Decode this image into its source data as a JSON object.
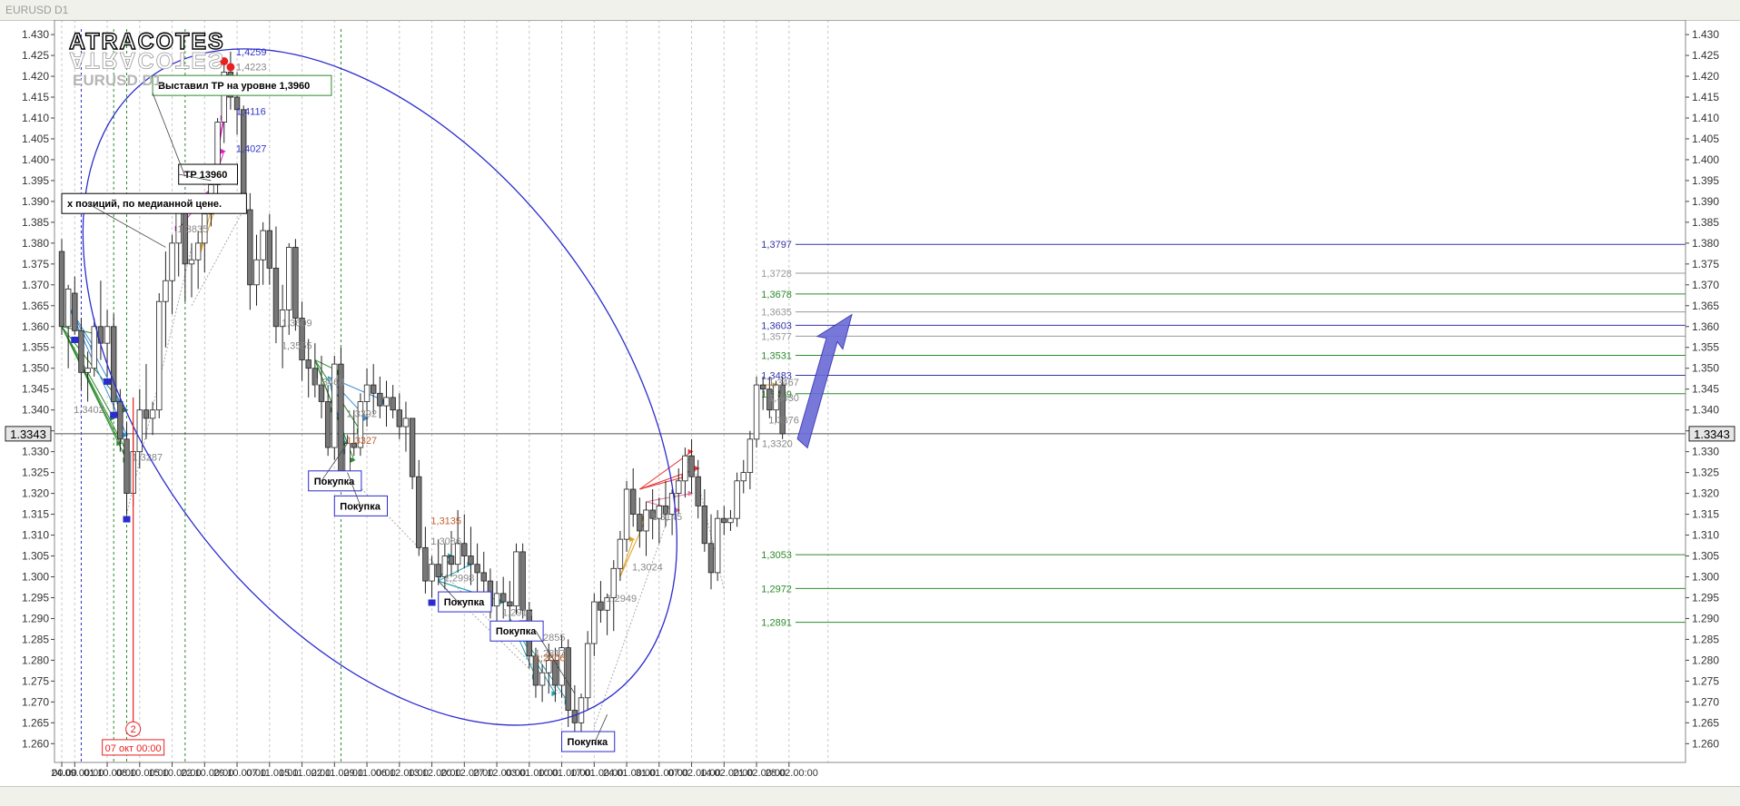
{
  "window": {
    "title": "EURUSD D1"
  },
  "brand": {
    "logo_text": "ATRACOTES",
    "symbol": "EURUSD D1"
  },
  "colors": {
    "bull": "#ffffff",
    "bear": "#777777",
    "accent_blue": "#2b2bd0",
    "accent_red": "#e82020",
    "axis": "#444444"
  },
  "chart_data": {
    "type": "candlestick",
    "ylim": [
      1.2555,
      1.4335
    ],
    "yticks": [
      "1.430",
      "1.425",
      "1.420",
      "1.415",
      "1.410",
      "1.405",
      "1.400",
      "1.395",
      "1.390",
      "1.385",
      "1.380",
      "1.375",
      "1.370",
      "1.365",
      "1.360",
      "1.355",
      "1.350",
      "1.345",
      "1.340",
      "1.335",
      "1.330",
      "1.325",
      "1.320",
      "1.315",
      "1.310",
      "1.305",
      "1.300",
      "1.295",
      "1.290",
      "1.285",
      "1.280",
      "1.275",
      "1.270",
      "1.265",
      "1.260"
    ],
    "current_price": "1.3343",
    "xticks": [
      {
        "label": "00.00",
        "bar": 0
      },
      {
        "label": "24.09.00:00",
        "bar": 2
      },
      {
        "label": "01.10.00:00",
        "bar": 7
      },
      {
        "label": "08.10.00:00",
        "bar": 12
      },
      {
        "label": "15.10.00:00",
        "bar": 17
      },
      {
        "label": "22.10.00:00",
        "bar": 22
      },
      {
        "label": "29.10.00:00",
        "bar": 27
      },
      {
        "label": "07.11.00:00",
        "bar": 32
      },
      {
        "label": "15.11.00:00",
        "bar": 37
      },
      {
        "label": "22.11.00:00",
        "bar": 42
      },
      {
        "label": "29.11.00:00",
        "bar": 47
      },
      {
        "label": "06.12.00:00",
        "bar": 52
      },
      {
        "label": "13.12.00:00",
        "bar": 57
      },
      {
        "label": "20.12.00:00",
        "bar": 62
      },
      {
        "label": "27.12.00:00",
        "bar": 67
      },
      {
        "label": "03.01.00:00",
        "bar": 72
      },
      {
        "label": "10.01.00:00",
        "bar": 77
      },
      {
        "label": "17.01.00:00",
        "bar": 82
      },
      {
        "label": "24.01.00:00",
        "bar": 87
      },
      {
        "label": "31.01.00:00",
        "bar": 92
      },
      {
        "label": "07.02.00:00",
        "bar": 97
      },
      {
        "label": "14.02.00:00",
        "bar": 102
      },
      {
        "label": "21.02.00:00",
        "bar": 107
      },
      {
        "label": "28.02.00:00",
        "bar": 112
      }
    ],
    "candles": [
      [
        1.378,
        1.381,
        1.358,
        1.36
      ],
      [
        1.36,
        1.37,
        1.35,
        1.369
      ],
      [
        1.368,
        1.372,
        1.358,
        1.359
      ],
      [
        1.359,
        1.362,
        1.345,
        1.349
      ],
      [
        1.349,
        1.354,
        1.342,
        1.35
      ],
      [
        1.35,
        1.362,
        1.348,
        1.36
      ],
      [
        1.36,
        1.371,
        1.352,
        1.356
      ],
      [
        1.356,
        1.364,
        1.348,
        1.36
      ],
      [
        1.36,
        1.363,
        1.34,
        1.342
      ],
      [
        1.342,
        1.345,
        1.33,
        1.333
      ],
      [
        1.333,
        1.337,
        1.315,
        1.32
      ],
      [
        1.32,
        1.334,
        1.317,
        1.33
      ],
      [
        1.33,
        1.345,
        1.326,
        1.34
      ],
      [
        1.34,
        1.351,
        1.333,
        1.338
      ],
      [
        1.338,
        1.342,
        1.334,
        1.34
      ],
      [
        1.34,
        1.368,
        1.338,
        1.366
      ],
      [
        1.366,
        1.378,
        1.355,
        1.371
      ],
      [
        1.371,
        1.382,
        1.363,
        1.38
      ],
      [
        1.38,
        1.39,
        1.372,
        1.388
      ],
      [
        1.388,
        1.391,
        1.366,
        1.375
      ],
      [
        1.375,
        1.38,
        1.367,
        1.376
      ],
      [
        1.376,
        1.383,
        1.369,
        1.38
      ],
      [
        1.38,
        1.39,
        1.373,
        1.387
      ],
      [
        1.387,
        1.397,
        1.384,
        1.394
      ],
      [
        1.394,
        1.41,
        1.388,
        1.409
      ],
      [
        1.409,
        1.424,
        1.404,
        1.421
      ],
      [
        1.421,
        1.4259,
        1.412,
        1.415
      ],
      [
        1.415,
        1.421,
        1.406,
        1.412
      ],
      [
        1.412,
        1.413,
        1.387,
        1.388
      ],
      [
        1.388,
        1.392,
        1.364,
        1.37
      ],
      [
        1.37,
        1.382,
        1.365,
        1.376
      ],
      [
        1.376,
        1.385,
        1.37,
        1.383
      ],
      [
        1.383,
        1.387,
        1.37,
        1.374
      ],
      [
        1.374,
        1.384,
        1.356,
        1.36
      ],
      [
        1.36,
        1.37,
        1.35,
        1.364
      ],
      [
        1.364,
        1.38,
        1.358,
        1.379
      ],
      [
        1.379,
        1.381,
        1.359,
        1.362
      ],
      [
        1.362,
        1.366,
        1.347,
        1.352
      ],
      [
        1.352,
        1.357,
        1.343,
        1.35
      ],
      [
        1.35,
        1.356,
        1.343,
        1.346
      ],
      [
        1.346,
        1.353,
        1.338,
        1.342
      ],
      [
        1.342,
        1.346,
        1.329,
        1.331
      ],
      [
        1.331,
        1.353,
        1.328,
        1.351
      ],
      [
        1.351,
        1.355,
        1.323,
        1.324
      ],
      [
        1.324,
        1.334,
        1.322,
        1.332
      ],
      [
        1.332,
        1.34,
        1.329,
        1.331
      ],
      [
        1.331,
        1.344,
        1.329,
        1.342
      ],
      [
        1.342,
        1.35,
        1.336,
        1.346
      ],
      [
        1.346,
        1.351,
        1.339,
        1.344
      ],
      [
        1.344,
        1.348,
        1.338,
        1.341
      ],
      [
        1.341,
        1.347,
        1.336,
        1.343
      ],
      [
        1.343,
        1.346,
        1.338,
        1.34
      ],
      [
        1.34,
        1.344,
        1.333,
        1.336
      ],
      [
        1.336,
        1.342,
        1.33,
        1.338
      ],
      [
        1.338,
        1.338,
        1.321,
        1.324
      ],
      [
        1.324,
        1.328,
        1.305,
        1.307
      ],
      [
        1.307,
        1.312,
        1.296,
        1.299
      ],
      [
        1.299,
        1.305,
        1.295,
        1.303
      ],
      [
        1.303,
        1.309,
        1.298,
        1.3
      ],
      [
        1.3,
        1.308,
        1.297,
        1.305
      ],
      [
        1.305,
        1.311,
        1.3,
        1.303
      ],
      [
        1.303,
        1.316,
        1.301,
        1.308
      ],
      [
        1.308,
        1.315,
        1.302,
        1.305
      ],
      [
        1.305,
        1.312,
        1.298,
        1.303
      ],
      [
        1.303,
        1.308,
        1.296,
        1.301
      ],
      [
        1.301,
        1.306,
        1.293,
        1.299
      ],
      [
        1.299,
        1.302,
        1.29,
        1.293
      ],
      [
        1.293,
        1.299,
        1.288,
        1.296
      ],
      [
        1.296,
        1.3,
        1.29,
        1.294
      ],
      [
        1.294,
        1.299,
        1.288,
        1.293
      ],
      [
        1.293,
        1.308,
        1.291,
        1.306
      ],
      [
        1.306,
        1.308,
        1.29,
        1.292
      ],
      [
        1.292,
        1.294,
        1.278,
        1.281
      ],
      [
        1.281,
        1.283,
        1.271,
        1.274
      ],
      [
        1.274,
        1.279,
        1.27,
        1.277
      ],
      [
        1.277,
        1.284,
        1.272,
        1.28
      ],
      [
        1.28,
        1.283,
        1.27,
        1.274
      ],
      [
        1.274,
        1.286,
        1.271,
        1.283
      ],
      [
        1.283,
        1.285,
        1.264,
        1.268
      ],
      [
        1.268,
        1.274,
        1.261,
        1.265
      ],
      [
        1.265,
        1.272,
        1.26,
        1.271
      ],
      [
        1.271,
        1.287,
        1.268,
        1.284
      ],
      [
        1.284,
        1.296,
        1.281,
        1.294
      ],
      [
        1.294,
        1.299,
        1.289,
        1.292
      ],
      [
        1.292,
        1.296,
        1.286,
        1.295
      ],
      [
        1.295,
        1.304,
        1.287,
        1.302
      ],
      [
        1.302,
        1.311,
        1.299,
        1.309
      ],
      [
        1.309,
        1.323,
        1.306,
        1.321
      ],
      [
        1.321,
        1.326,
        1.312,
        1.315
      ],
      [
        1.315,
        1.319,
        1.307,
        1.311
      ],
      [
        1.311,
        1.318,
        1.305,
        1.316
      ],
      [
        1.316,
        1.321,
        1.309,
        1.314
      ],
      [
        1.314,
        1.319,
        1.308,
        1.317
      ],
      [
        1.317,
        1.323,
        1.312,
        1.315
      ],
      [
        1.315,
        1.321,
        1.31,
        1.32
      ],
      [
        1.32,
        1.326,
        1.315,
        1.323
      ],
      [
        1.323,
        1.331,
        1.319,
        1.329
      ],
      [
        1.329,
        1.333,
        1.32,
        1.324
      ],
      [
        1.324,
        1.328,
        1.314,
        1.317
      ],
      [
        1.317,
        1.321,
        1.306,
        1.308
      ],
      [
        1.308,
        1.315,
        1.297,
        1.301
      ],
      [
        1.301,
        1.316,
        1.299,
        1.314
      ],
      [
        1.314,
        1.317,
        1.31,
        1.313
      ],
      [
        1.313,
        1.316,
        1.311,
        1.314
      ],
      [
        1.314,
        1.325,
        1.312,
        1.323
      ],
      [
        1.323,
        1.328,
        1.32,
        1.325
      ],
      [
        1.325,
        1.335,
        1.321,
        1.333
      ],
      [
        1.333,
        1.348,
        1.331,
        1.346
      ],
      [
        1.346,
        1.348,
        1.34,
        1.345
      ],
      [
        1.345,
        1.348,
        1.338,
        1.34
      ],
      [
        1.34,
        1.347,
        1.337,
        1.346
      ],
      [
        1.346,
        1.348,
        1.333,
        1.3343
      ]
    ],
    "level_lines": [
      {
        "label": "1,3797",
        "price": 1.3797,
        "color": "#3333aa"
      },
      {
        "label": "1,3728",
        "price": 1.3728,
        "color": "#999999"
      },
      {
        "label": "1,3678",
        "price": 1.3678,
        "color": "#2c8a2c"
      },
      {
        "label": "1,3635",
        "price": 1.3635,
        "color": "#999999"
      },
      {
        "label": "1,3603",
        "price": 1.3603,
        "color": "#3333aa"
      },
      {
        "label": "1,3577",
        "price": 1.3577,
        "color": "#999999"
      },
      {
        "label": "1,3531",
        "price": 1.3531,
        "color": "#2c8a2c"
      },
      {
        "label": "1,3483",
        "price": 1.3483,
        "color": "#3333aa"
      },
      {
        "label": "1,3439",
        "price": 1.3439,
        "color": "#2c8a2c"
      },
      {
        "label": "1,3053",
        "price": 1.3053,
        "color": "#2c8a2c"
      },
      {
        "label": "1,2972",
        "price": 1.2972,
        "color": "#2c8a2c"
      },
      {
        "label": "1,2891",
        "price": 1.2891,
        "color": "#2c8a2c"
      }
    ],
    "price_labels": [
      {
        "label": "1,4259",
        "bar": 26,
        "price": 1.4259,
        "color": "#3333cc"
      },
      {
        "label": "1,4223",
        "bar": 26,
        "price": 1.4223,
        "color": "#888888"
      },
      {
        "label": "1,4116",
        "bar": 26,
        "price": 1.4116,
        "color": "#3333cc"
      },
      {
        "label": "1,4027",
        "bar": 26,
        "price": 1.4027,
        "color": "#3333cc"
      },
      {
        "label": "1,3835",
        "bar": 17,
        "price": 1.3835,
        "color": "#888888"
      },
      {
        "label": "1,3609",
        "bar": 33,
        "price": 1.3609,
        "color": "#888888"
      },
      {
        "label": "1,3555",
        "bar": 33,
        "price": 1.3555,
        "color": "#888888"
      },
      {
        "label": "1,3468",
        "bar": 38,
        "price": 1.3468,
        "color": "#888888"
      },
      {
        "label": "1,3402",
        "bar": 1,
        "price": 1.3402,
        "color": "#888888"
      },
      {
        "label": "1,3392",
        "bar": 43,
        "price": 1.3392,
        "color": "#888888"
      },
      {
        "label": "1,3327",
        "bar": 43,
        "price": 1.3327,
        "color": "#c06030"
      },
      {
        "label": "1,3287",
        "bar": 10,
        "price": 1.3287,
        "color": "#888888"
      },
      {
        "label": "1,3135",
        "bar": 56,
        "price": 1.3135,
        "color": "#c06030"
      },
      {
        "label": "1,3086",
        "bar": 56,
        "price": 1.3086,
        "color": "#888888"
      },
      {
        "label": "1,3145",
        "bar": 90,
        "price": 1.3145,
        "color": "#888888"
      },
      {
        "label": "1,3024",
        "bar": 87,
        "price": 1.3024,
        "color": "#888888"
      },
      {
        "label": "1,2998",
        "bar": 58,
        "price": 1.2998,
        "color": "#888888"
      },
      {
        "label": "1,2949",
        "bar": 83,
        "price": 1.2949,
        "color": "#888888"
      },
      {
        "label": "1,2915",
        "bar": 67,
        "price": 1.2915,
        "color": "#888888"
      },
      {
        "label": "1,2878",
        "bar": 68,
        "price": 1.2878,
        "color": "#888888"
      },
      {
        "label": "1,2855",
        "bar": 72,
        "price": 1.2855,
        "color": "#888888"
      },
      {
        "label": "1,2817",
        "bar": 72,
        "price": 1.2817,
        "color": "#888888"
      },
      {
        "label": "1,2806",
        "bar": 72,
        "price": 1.2806,
        "color": "#c06030"
      },
      {
        "label": "1,3467",
        "bar": 108,
        "price": 1.3467,
        "color": "#888888"
      },
      {
        "label": "1,3430",
        "bar": 108,
        "price": 1.343,
        "color": "#888888"
      },
      {
        "label": "1,3376",
        "bar": 108,
        "price": 1.3376,
        "color": "#888888"
      },
      {
        "label": "1,3320",
        "bar": 107,
        "price": 1.332,
        "color": "#888888"
      }
    ],
    "annotations": [
      {
        "text": "Выставил ТР на уровне 1,3960",
        "bar": 14,
        "price": 1.4178,
        "style": "green"
      },
      {
        "text": "ТР 13960",
        "bar": 18,
        "price": 1.3965,
        "style": "black"
      },
      {
        "text": "х позиций, по медианной цене.",
        "bar": 0,
        "price": 1.3895,
        "style": "black"
      },
      {
        "text": "Покупка",
        "bar": 38,
        "price": 1.323,
        "style": "blue"
      },
      {
        "text": "Покупка",
        "bar": 42,
        "price": 1.317,
        "style": "blue"
      },
      {
        "text": "Покупка",
        "bar": 58,
        "price": 1.294,
        "style": "blue"
      },
      {
        "text": "Покупка",
        "bar": 66,
        "price": 1.287,
        "style": "blue"
      },
      {
        "text": "Покупка",
        "bar": 77,
        "price": 1.2605,
        "style": "blue"
      }
    ],
    "time_marker": {
      "label": "07 окт 00:00",
      "number": "2",
      "bar": 11
    }
  }
}
